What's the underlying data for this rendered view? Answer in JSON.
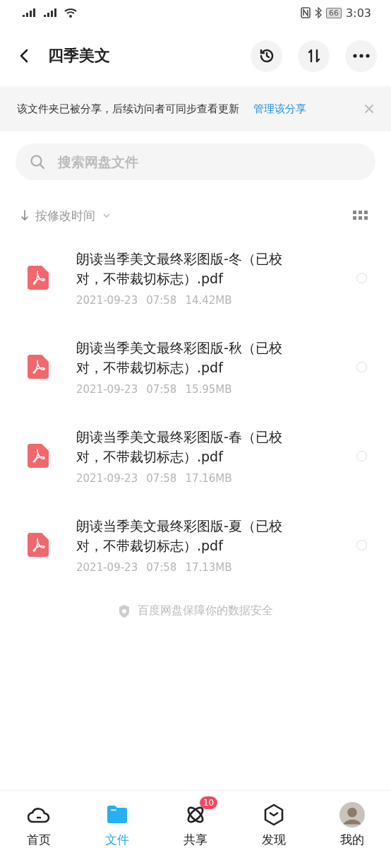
{
  "status_bar": {
    "time": "3:03",
    "battery": "66"
  },
  "header": {
    "title": "四季美文"
  },
  "share_banner": {
    "text": "该文件夹已被分享，后续访问者可同步查看更新",
    "link": "管理该分享"
  },
  "search": {
    "placeholder": "搜索网盘文件"
  },
  "sort": {
    "label": "按修改时间"
  },
  "files": [
    {
      "name": "朗读当季美文最终彩图版-冬（已校对，不带裁切标志）.pdf",
      "date": "2021-09-23",
      "time": "07:58",
      "size": "14.42MB",
      "selected": false
    },
    {
      "name": "朗读当季美文最终彩图版-秋（已校对，不带裁切标志）.pdf",
      "date": "2021-09-23",
      "time": "07:58",
      "size": "15.95MB",
      "selected": false
    },
    {
      "name": "朗读当季美文最终彩图版-春（已校对，不带裁切标志）.pdf",
      "date": "2021-09-23",
      "time": "07:58",
      "size": "17.16MB",
      "selected": false
    },
    {
      "name": "朗读当季美文最终彩图版-夏（已校对，不带裁切标志）.pdf",
      "date": "2021-09-23",
      "time": "07:58",
      "size": "17.13MB",
      "selected": false
    }
  ],
  "footer_note": "百度网盘保障你的数据安全",
  "tabs": [
    {
      "label": "首页",
      "kind": "cloud",
      "selected": false
    },
    {
      "label": "文件",
      "kind": "folder",
      "selected": true
    },
    {
      "label": "共享",
      "kind": "atom",
      "selected": false,
      "badge": "10"
    },
    {
      "label": "发现",
      "kind": "cube",
      "selected": false
    },
    {
      "label": "我的",
      "kind": "avatar",
      "selected": false
    }
  ]
}
